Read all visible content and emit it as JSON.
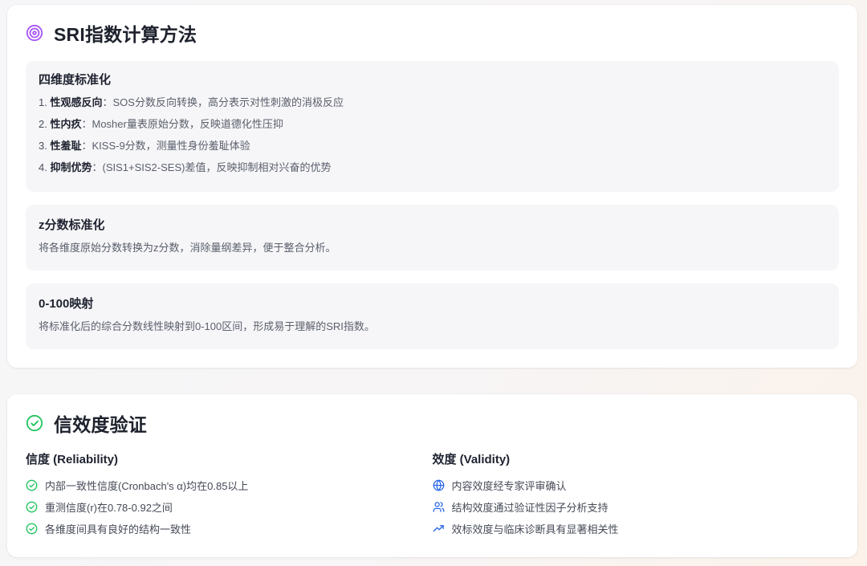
{
  "method": {
    "title": "SRI指数计算方法",
    "icon": "target-icon",
    "accent": "#a855f7",
    "blocks": {
      "dimensions": {
        "title": "四维度标准化",
        "items": [
          {
            "num": "1.",
            "key": "性观感反向",
            "sep": "：",
            "desc": "SOS分数反向转换，高分表示对性刺激的消极反应"
          },
          {
            "num": "2.",
            "key": "性内疚",
            "sep": "：",
            "desc": "Mosher量表原始分数，反映道德化性压抑"
          },
          {
            "num": "3.",
            "key": "性羞耻",
            "sep": "：",
            "desc": "KISS-9分数，测量性身份羞耻体验"
          },
          {
            "num": "4.",
            "key": "抑制优势",
            "sep": "：",
            "desc": "(SIS1+SIS2-SES)差值，反映抑制相对兴奋的优势"
          }
        ]
      },
      "zscore": {
        "title": "z分数标准化",
        "text": "将各维度原始分数转换为z分数，消除量纲差异，便于整合分析。"
      },
      "mapping": {
        "title": "0-100映射",
        "text": "将标准化后的综合分数线性映射到0-100区间，形成易于理解的SRI指数。"
      }
    }
  },
  "validity": {
    "title": "信效度验证",
    "icon": "check-circle-icon",
    "accent": "#22c55e",
    "reliability": {
      "title": "信度 (Reliability)",
      "items": [
        {
          "icon": "check-circle-icon",
          "text": "内部一致性信度(Cronbach's α)均在0.85以上"
        },
        {
          "icon": "check-circle-icon",
          "text": "重测信度(r)在0.78-0.92之间"
        },
        {
          "icon": "check-circle-icon",
          "text": "各维度间具有良好的结构一致性"
        }
      ]
    },
    "validity_col": {
      "title": "效度 (Validity)",
      "accent": "#2563eb",
      "items": [
        {
          "icon": "globe-icon",
          "text": "内容效度经专家评审确认"
        },
        {
          "icon": "users-icon",
          "text": "结构效度通过验证性因子分析支持"
        },
        {
          "icon": "trending-up-icon",
          "text": "效标效度与临床诊断具有显著相关性"
        }
      ]
    }
  }
}
